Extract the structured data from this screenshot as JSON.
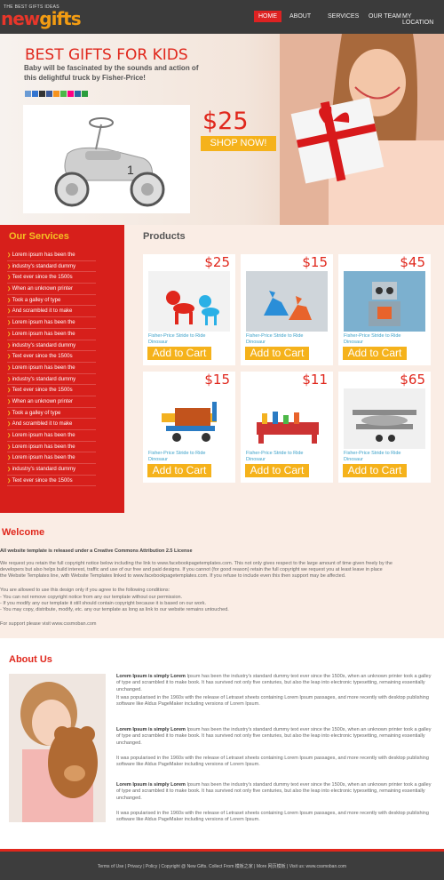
{
  "header": {
    "logo_tagline": "THE BEST GIFTS IDEAS",
    "logo_part1": "new",
    "logo_part2": "gifts",
    "nav": [
      "HOME",
      "ABOUT",
      "SERVICES",
      "OUR TEAM",
      "MY LOCATION"
    ]
  },
  "hero": {
    "title": "BEST GIFTS FOR KIDS",
    "subtitle": "Baby will be fascinated by the sounds and action of this delightful truck by Fisher-Price!",
    "price": "$25",
    "button": "SHOP NOW!"
  },
  "sidebar": {
    "title": "Our Services",
    "items": [
      "Lorem ipsum has been the",
      "industry's standard dummy",
      "Text ever since the 1500s",
      "When an unknown printer",
      "Took a galley of type",
      "And scrambled it to make",
      "Lorem ipsum has been the",
      "Lorem ipsum has been the",
      "industry's standard dummy",
      "Text ever since the 1500s",
      "Lorem ipsum has been the",
      "industry's standard dummy",
      "Text ever since the 1500s",
      "When an unknown printer",
      "Took a galley of type",
      "And scrambled it to make",
      "Lorem ipsum has been the",
      "Lorem ipsum has been the",
      "Lorem ipsum has been the",
      "industry's standard dummy",
      "Text ever since the 1500s"
    ]
  },
  "products": {
    "title": "Products",
    "items": [
      {
        "price": "$25",
        "name": "Fisher-Price Stride to Ride Dinosaur",
        "button": "Add to Cart",
        "icon": "balloon-dog-icon"
      },
      {
        "price": "$15",
        "name": "Fisher-Price Stride to Ride Dinosaur",
        "button": "Add to Cart",
        "icon": "dinosaur-toys-icon"
      },
      {
        "price": "$45",
        "name": "Fisher-Price Stride to Ride Dinosaur",
        "button": "Add to Cart",
        "icon": "robot-icon"
      },
      {
        "price": "$15",
        "name": "Fisher-Price Stride to Ride Dinosaur",
        "button": "Add to Cart",
        "icon": "toy-plane-icon"
      },
      {
        "price": "$11",
        "name": "Fisher-Price Stride to Ride Dinosaur",
        "button": "Add to Cart",
        "icon": "peg-bench-icon"
      },
      {
        "price": "$65",
        "name": "Fisher-Price Stride to Ride Dinosaur",
        "button": "Add to Cart",
        "icon": "biplane-icon"
      }
    ]
  },
  "welcome": {
    "title": "Welcome",
    "lines": [
      "All website template is released under a Creative Commons Attribution 2.5 License",
      "We request you retain the full copyright notice below including the link to www.facebookpagetemplates.com. This not only gives respect to the large amount of time given freely by the",
      "developers but also helps build interest, traffic and use of our free and paid designs. If you cannot (for good reason) retain the full copyright we request you at least leave in place",
      "the Website Templates line, with Website Templates linked to www.facebookpagetemplates.com. If you refuse to include even this then support may be affected.",
      "You are allowed to use this design only if you agree to the following conditions:",
      "- You can not remove copyright notice from any our template without our permission.",
      "- If you modify any our template it still should contain copyright because it is based on our work.",
      "- You may copy, distribute, modify, etc. any our template as long as link to our website remains untouched.",
      "For support please visit www.cssmoban.com"
    ]
  },
  "about": {
    "title": "About Us",
    "para_bold": "Lorem Ipsum is simply Lorem",
    "para_rest1": "Ipsum has been the industry's standard dummy text ever since the 1500s, when an unknown printer took a galley of type and scrambled it to make book. It has survived not only five centuries, but also the leap into electronic typesetting, remaining essentially unchanged.",
    "para2": "It was popularised in the 1960s with the release of Letraset sheets containing Lorem Ipsum passages, and more recently with desktop publishing software like Aldus PageMaker including versions of Lorem Ipsum."
  },
  "footer": {
    "text": "Terms of Use | Privacy | Policy | Copyright @ New Gifts. Collect From 模板之家 | More 网页模板 | Visit us: www.cssmoban.com"
  }
}
